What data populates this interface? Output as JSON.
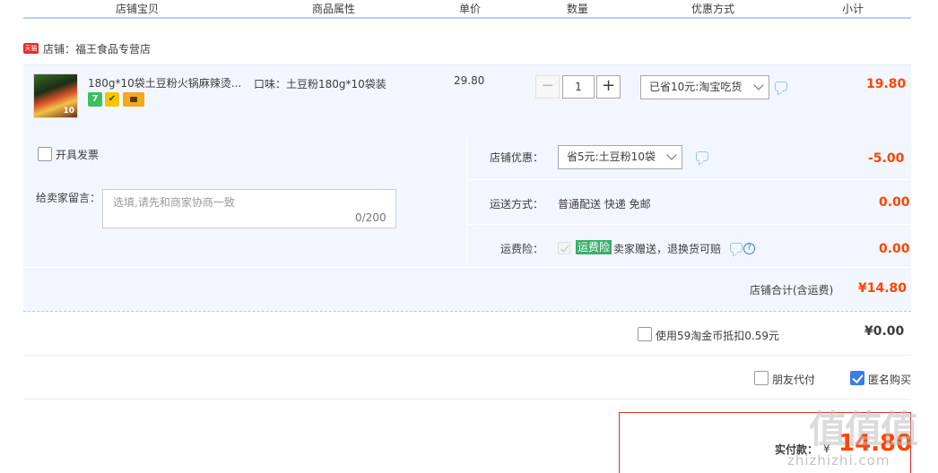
{
  "columns": {
    "item": "店铺宝贝",
    "attrs": "商品属性",
    "price": "单价",
    "qty": "数量",
    "promo": "优惠方式",
    "subtotal": "小计"
  },
  "store": {
    "badge": "天猫",
    "name": "店铺：福王食品专营店"
  },
  "item": {
    "title": "180g*10袋土豆粉火锅麻辣烫...",
    "attr": "口味：土豆粉180g*10袋装",
    "price": "29.80",
    "qty_minus": "−",
    "qty": "1",
    "qty_plus": "+",
    "promo": "已省10元:淘宝吃货",
    "subtotal": "19.80",
    "badges": {
      "seven": "7",
      "shield": "✔"
    }
  },
  "invoice": {
    "label": "开具发票",
    "checked": false
  },
  "memo": {
    "label": "给卖家留言：",
    "placeholder": "选填,请先和商家协商一致",
    "count": "0/200"
  },
  "store_discount": {
    "label": "店铺优惠：",
    "value": "省5元:土豆粉10袋",
    "amount": "-5.00"
  },
  "shipping": {
    "label": "运送方式：",
    "value": "普通配送 快递 免邮",
    "amount": "0.00"
  },
  "insurance": {
    "label": "运费险：",
    "tag": "运费险",
    "desc": "卖家赠送，退换货可赔",
    "amount": "0.00",
    "help": "?"
  },
  "store_total": {
    "label": "店铺合计(含运费)",
    "value": "¥14.80"
  },
  "coins": {
    "label": "使用59淘金币抵扣0.59元",
    "value": "¥0.00"
  },
  "options": {
    "friend_pay": "朋友代付",
    "anonymous": "匿名购买"
  },
  "pay": {
    "label": "实付款：",
    "currency": "¥",
    "value": "14.80"
  },
  "watermark": {
    "logo": "值值值",
    "site": "zhizhizhi.com"
  },
  "colors": {
    "accent_red": "#ff4400",
    "panel_bg": "#f2f7ff",
    "header_line": "#b2d1ff",
    "checkbox_blue": "#3c7be8",
    "insurance_green": "#3cae6b"
  }
}
